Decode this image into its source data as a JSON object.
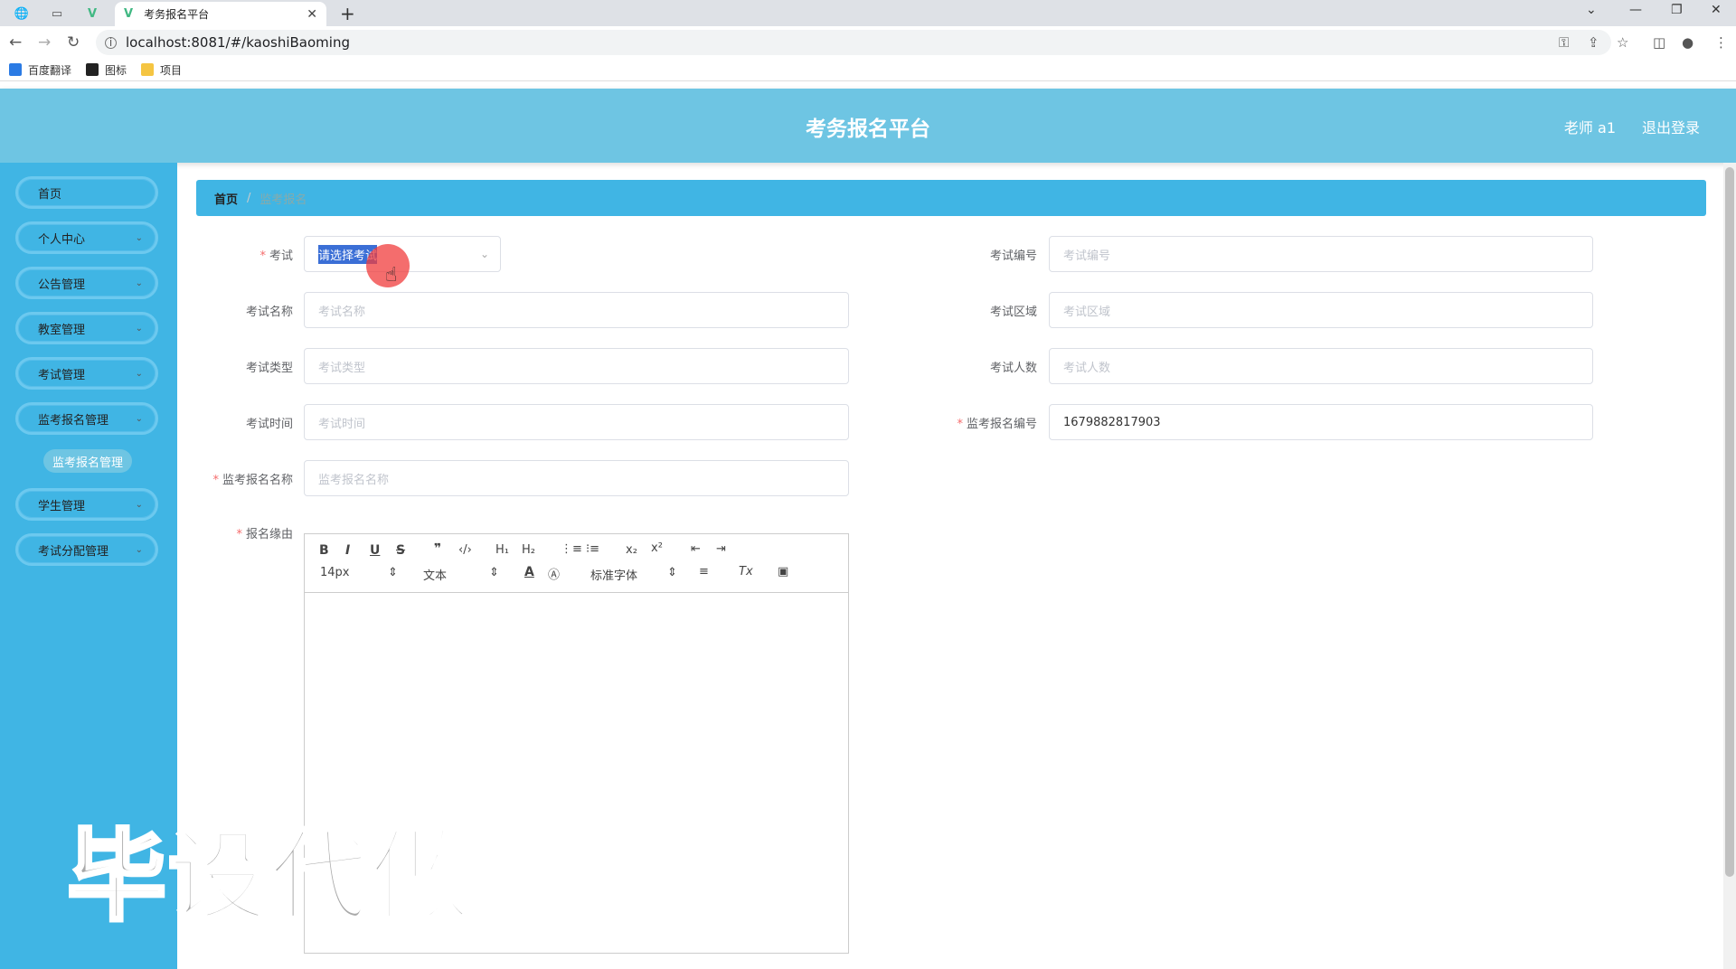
{
  "browser": {
    "tab_title": "考务报名平台",
    "url": "localhost:8081/#/kaoshiBaoming",
    "bookmarks": [
      {
        "label": "百度翻译"
      },
      {
        "label": "图标"
      },
      {
        "label": "项目"
      }
    ]
  },
  "header": {
    "title": "考务报名平台",
    "user": "老师 a1",
    "logout": "退出登录"
  },
  "sidebar": {
    "items": [
      {
        "label": "首页"
      },
      {
        "label": "个人中心"
      },
      {
        "label": "公告管理"
      },
      {
        "label": "教室管理"
      },
      {
        "label": "考试管理"
      },
      {
        "label": "监考报名管理"
      },
      {
        "label": "学生管理"
      },
      {
        "label": "考试分配管理"
      }
    ],
    "submenu": {
      "label": "监考报名管理"
    }
  },
  "breadcrumb": {
    "home": "首页",
    "current": "监考报名"
  },
  "form": {
    "exam": {
      "label": "考试",
      "placeholder": "请选择考试"
    },
    "exam_no": {
      "label": "考试编号",
      "placeholder": "考试编号"
    },
    "exam_name": {
      "label": "考试名称",
      "placeholder": "考试名称"
    },
    "exam_area": {
      "label": "考试区域",
      "placeholder": "考试区域"
    },
    "exam_type": {
      "label": "考试类型",
      "placeholder": "考试类型"
    },
    "exam_count": {
      "label": "考试人数",
      "placeholder": "考试人数"
    },
    "exam_time": {
      "label": "考试时间",
      "placeholder": "考试时间"
    },
    "invig_no": {
      "label": "监考报名编号",
      "value": "1679882817903"
    },
    "invig_name": {
      "label": "监考报名名称",
      "placeholder": "监考报名名称"
    },
    "reason": {
      "label": "报名缘由"
    }
  },
  "editor": {
    "font_size": "14px",
    "header_select": "文本",
    "font_family": "标准字体"
  },
  "watermark": "毕设代做"
}
